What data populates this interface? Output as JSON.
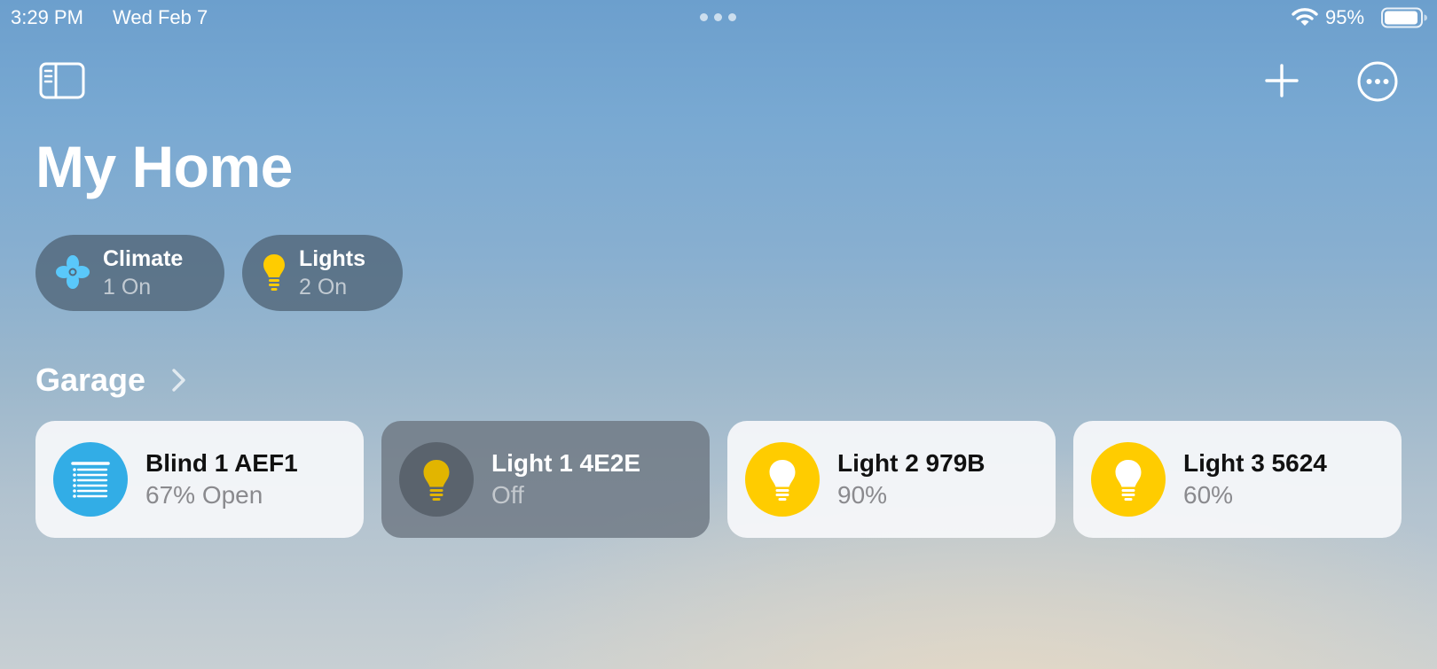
{
  "status_bar": {
    "time": "3:29 PM",
    "date": "Wed Feb 7",
    "battery_percent": "95%",
    "battery_level": 0.95,
    "icons": [
      "wifi-icon",
      "battery-icon"
    ]
  },
  "toolbar": {
    "icons": [
      "sidebar-icon",
      "plus-icon",
      "ellipsis-circle-icon"
    ]
  },
  "page": {
    "title": "My Home"
  },
  "summary": [
    {
      "title": "Climate",
      "status": "1 On",
      "icon": "fan-icon",
      "icon_color": "#5ac8fa"
    },
    {
      "title": "Lights",
      "status": "2 On",
      "icon": "lightbulb-icon",
      "icon_color": "#ffcc00"
    }
  ],
  "section": {
    "title": "Garage",
    "icon": "chevron-right-icon"
  },
  "accessories": [
    {
      "name": "Blind 1 AEF1",
      "status": "67% Open",
      "icon": "blinds-icon",
      "circle_color": "#32ade6",
      "state": "on"
    },
    {
      "name": "Light 1 4E2E",
      "status": "Off",
      "icon": "lightbulb-icon",
      "circle_color": "#5a636d",
      "state": "off"
    },
    {
      "name": "Light 2 979B",
      "status": "90%",
      "icon": "lightbulb-icon",
      "circle_color": "#ffcc00",
      "state": "on"
    },
    {
      "name": "Light 3 5624",
      "status": "60%",
      "icon": "lightbulb-icon",
      "circle_color": "#ffcc00",
      "state": "on"
    }
  ]
}
